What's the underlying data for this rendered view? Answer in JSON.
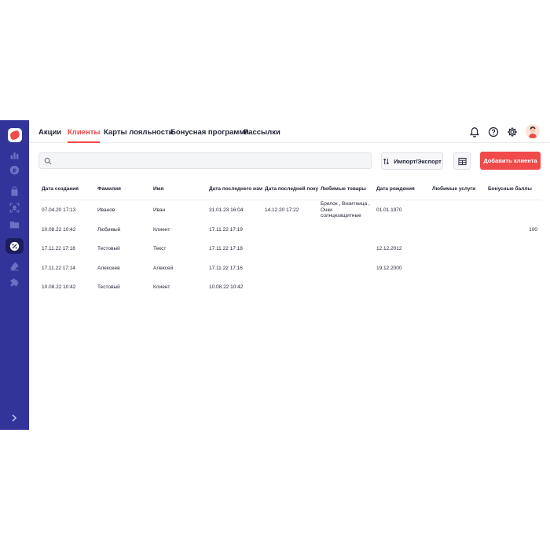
{
  "nav": {
    "tabs": [
      {
        "label": "Акции",
        "active": false
      },
      {
        "label": "Клиенты",
        "active": true
      },
      {
        "label": "Карты лояльности",
        "active": false
      },
      {
        "label": "Бонусная программа",
        "active": false
      },
      {
        "label": "Рассылки",
        "active": false
      }
    ]
  },
  "toolbar": {
    "search_placeholder": "",
    "import_export_label": "Импорт/Экспорт",
    "add_client_label": "Добавить клиента"
  },
  "table": {
    "headers": [
      "Дата создания",
      "Фамилия",
      "Имя",
      "Дата последнего изм",
      "Дата последней поку",
      "Любимые товары",
      "Дата рождения",
      "Любимые услуги",
      "Бонусные баллы"
    ],
    "rows": [
      {
        "created": "07.04.20 17:13",
        "last_name": "Иванов",
        "first_name": "Иван",
        "modified": "31.01.23 16:04",
        "last_purchase": "14.12.20 17:22",
        "fav_products": "Брелок , Визитница , Очки солнцезащитные",
        "birthday": "01.01.1970",
        "fav_services": "",
        "bonus": ""
      },
      {
        "created": "10.08.22 10:42",
        "last_name": "Любимый",
        "first_name": "Клиент",
        "modified": "17.11.22 17:19",
        "last_purchase": "",
        "fav_products": "",
        "birthday": "",
        "fav_services": "",
        "bonus": "100"
      },
      {
        "created": "17.11.22 17:18",
        "last_name": "Тестовый",
        "first_name": "Текст",
        "modified": "17.11.22 17:18",
        "last_purchase": "",
        "fav_products": "",
        "birthday": "12.12.2012",
        "fav_services": "",
        "bonus": ""
      },
      {
        "created": "17.11.22 17:14",
        "last_name": "Алексеев",
        "first_name": "Алексей",
        "modified": "17.11.22 17:16",
        "last_purchase": "",
        "fav_products": "",
        "birthday": "19.12.2000",
        "fav_services": "",
        "bonus": ""
      },
      {
        "created": "10.08.22 10:42",
        "last_name": "Тестовый",
        "first_name": "Клиент",
        "modified": "10.08.22 10:42",
        "last_purchase": "",
        "fav_products": "",
        "birthday": "",
        "fav_services": "",
        "bonus": ""
      }
    ]
  },
  "colors": {
    "sidebar": "#33349a",
    "sidebar_active": "#1c1d5e",
    "accent": "#f04a4a",
    "text": "#1f2233"
  },
  "icons": {
    "sidebar": [
      "bar-chart-icon",
      "ruble-icon",
      "bag-icon",
      "scan-icon",
      "folder-icon",
      "percent-icon",
      "eraser-icon",
      "puzzle-icon"
    ],
    "top": [
      "bell-icon",
      "help-icon",
      "gear-icon"
    ]
  }
}
